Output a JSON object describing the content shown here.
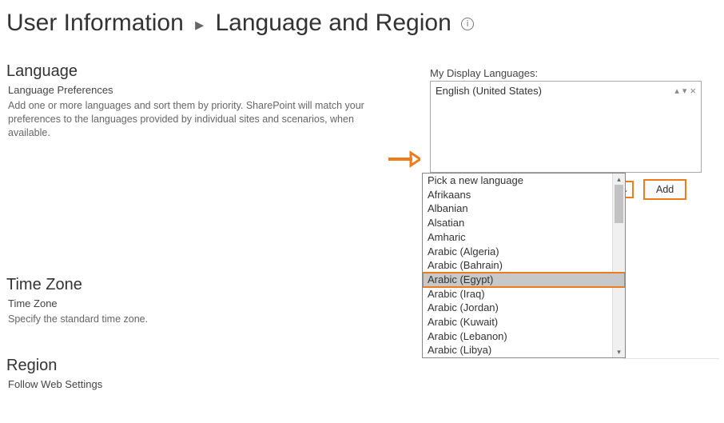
{
  "breadcrumb": {
    "parent": "User Information",
    "current": "Language and Region"
  },
  "language": {
    "heading": "Language",
    "sub": "Language Preferences",
    "desc": "Add one or more languages and sort them by priority. SharePoint will match your preferences to the languages provided by individual sites and scenarios, when available.",
    "display_label": "My Display Languages:",
    "selected_language": "English (United States)",
    "picker_selected": "Pick a new language",
    "add_label": "Add",
    "options": [
      "Pick a new language",
      "Afrikaans",
      "Albanian",
      "Alsatian",
      "Amharic",
      "Arabic (Algeria)",
      "Arabic (Bahrain)",
      "Arabic (Egypt)",
      "Arabic (Iraq)",
      "Arabic (Jordan)",
      "Arabic (Kuwait)",
      "Arabic (Lebanon)",
      "Arabic (Libya)"
    ],
    "highlight_index": 7
  },
  "timezone": {
    "heading": "Time Zone",
    "sub": "Time Zone",
    "desc": "Specify the standard time zone."
  },
  "region": {
    "heading": "Region",
    "sub": "Follow Web Settings"
  }
}
